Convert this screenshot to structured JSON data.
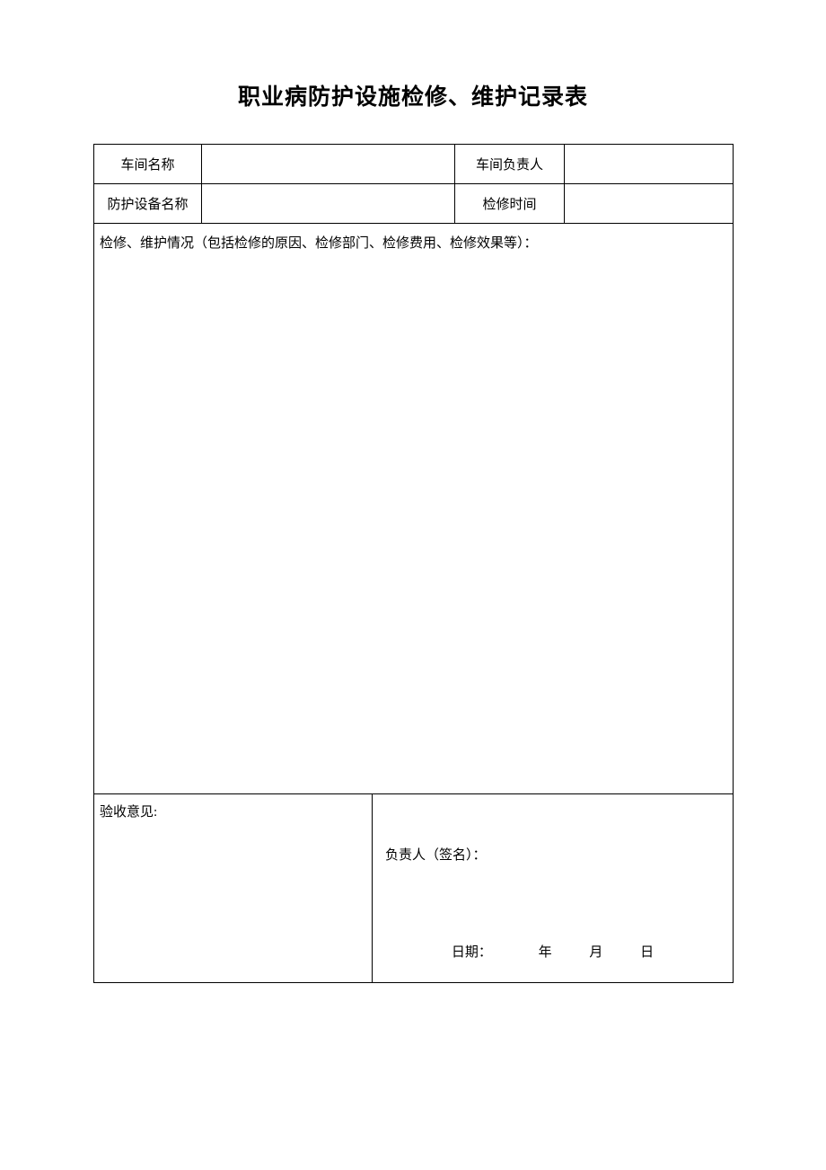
{
  "title": "职业病防护设施检修、维护记录表",
  "row1": {
    "label_workshop": "车间名称",
    "value_workshop": "",
    "label_manager": "车间负责人",
    "value_manager": ""
  },
  "row2": {
    "label_equipment": "防护设备名称",
    "value_equipment": "",
    "label_time": "检修时间",
    "value_time": ""
  },
  "maintenance": {
    "label": "检修、维护情况（包括检修的原因、检修部门、检修费用、检修效果等）：",
    "content": ""
  },
  "acceptance": {
    "label": "验收意见:",
    "content": ""
  },
  "signature": {
    "label": "负责人（签名）：",
    "date_label": "日期：",
    "year_unit": "年",
    "month_unit": "月",
    "day_unit": "日"
  }
}
